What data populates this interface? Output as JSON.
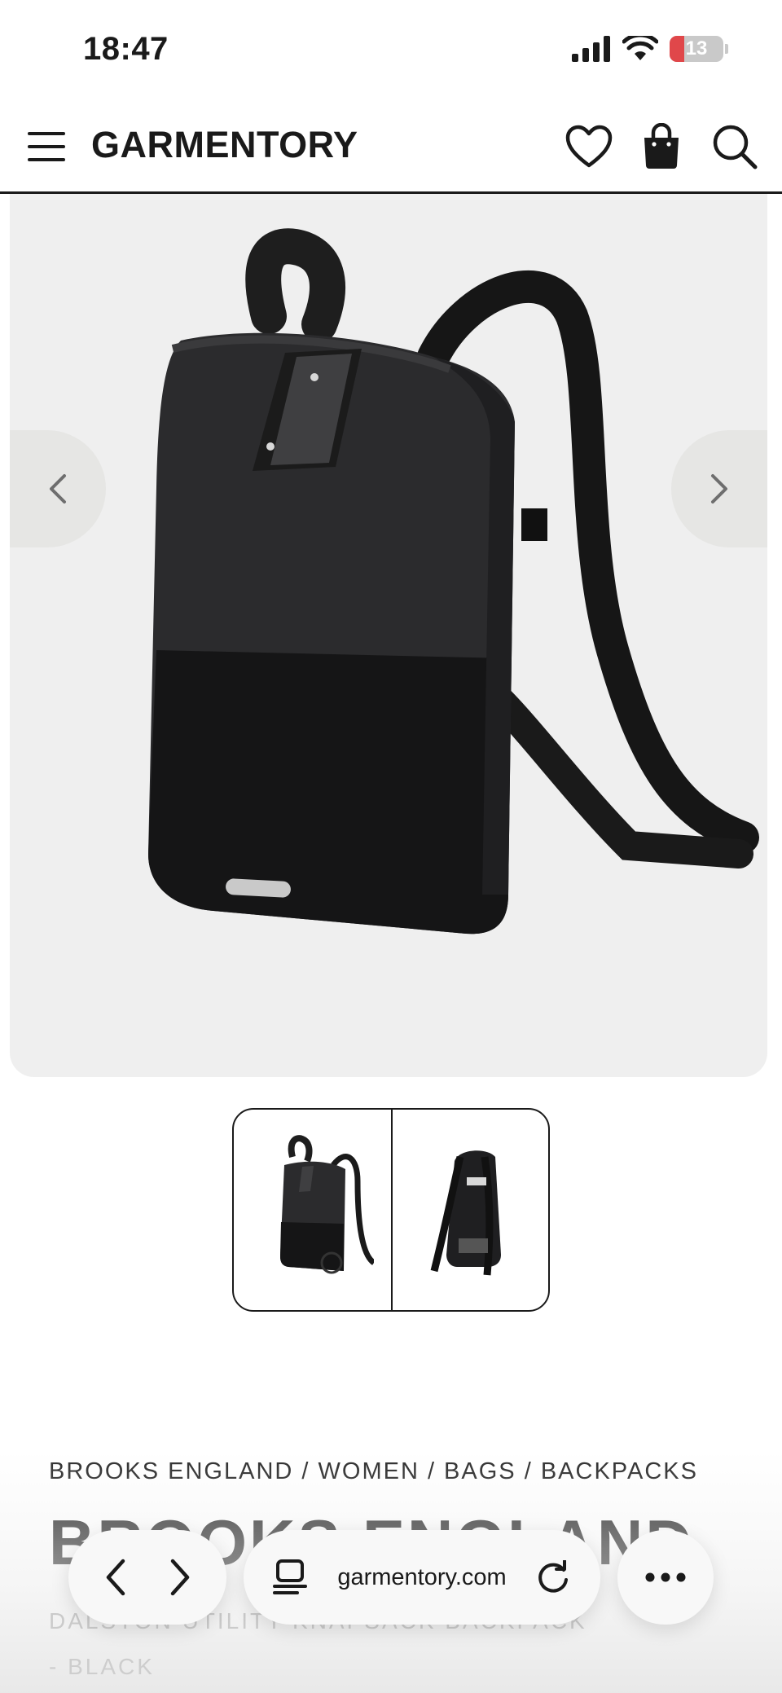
{
  "status_bar": {
    "time": "18:47",
    "battery_level": "13"
  },
  "header": {
    "logo": "GARMENTORY"
  },
  "product": {
    "breadcrumb": "BROOKS ENGLAND / WOMEN / BAGS / BACKPACKS",
    "title": "BROOKS ENGLAND",
    "subtitle_line1": "DALSTON UTILITY KNAPSACK BACKPACK",
    "subtitle_line2": "- BLACK"
  },
  "browser": {
    "url": "garmentory.com"
  },
  "colors": {
    "text": "#1a1a1a",
    "hero_bg": "#efefef",
    "battery_low": "#e0474a"
  }
}
